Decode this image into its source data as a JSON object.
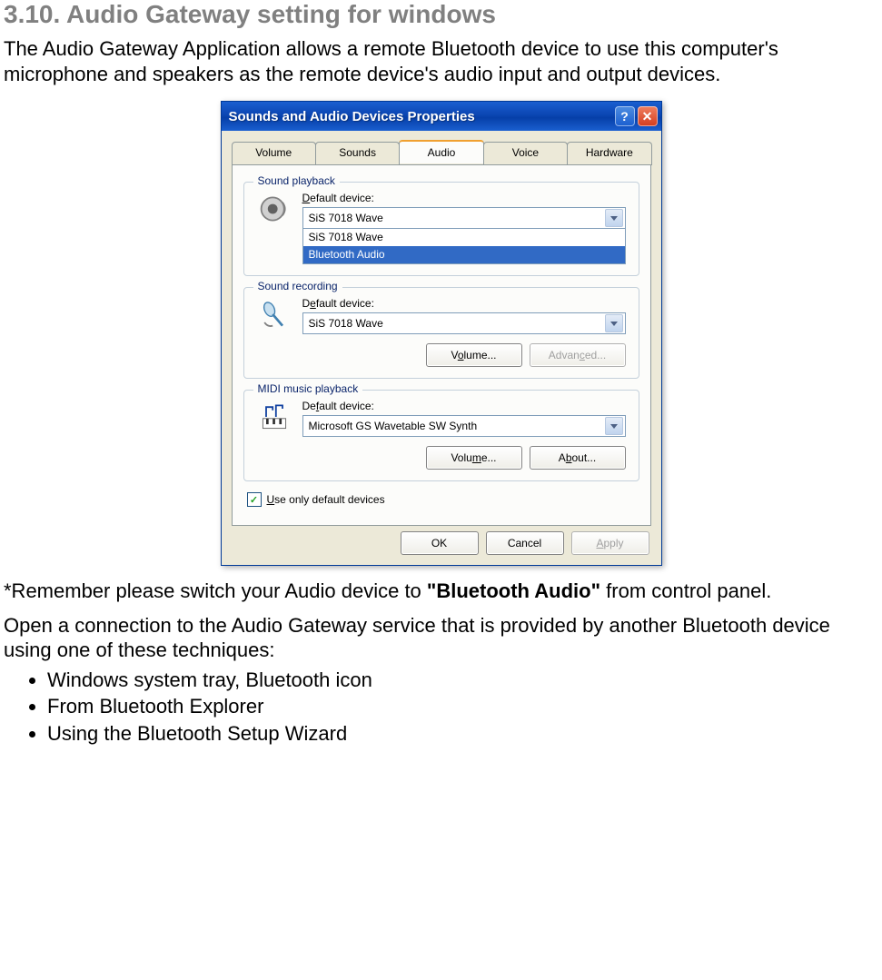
{
  "heading": "3.10. Audio Gateway setting for windows",
  "intro": "The Audio Gateway Application allows a remote Bluetooth device to use this computer's microphone and speakers as the remote device's audio input and output devices.",
  "dialog": {
    "title": "Sounds and Audio Devices Properties",
    "tabs": [
      "Volume",
      "Sounds",
      "Audio",
      "Voice",
      "Hardware"
    ],
    "active_tab_index": 2,
    "playback": {
      "group_title": "Sound playback",
      "label_pre": "D",
      "label_post": "efault device:",
      "value": "SiS 7018 Wave",
      "options": [
        "SiS 7018 Wave",
        "Bluetooth Audio"
      ],
      "selected_option_index": 1
    },
    "recording": {
      "group_title": "Sound recording",
      "label_pre": "D",
      "label_mid": "e",
      "label_post": "fault device:",
      "value": "SiS 7018 Wave",
      "volume_btn_pre": "V",
      "volume_btn_mid": "o",
      "volume_btn_post": "lume...",
      "advanced_btn_pre": "Advan",
      "advanced_btn_mid": "c",
      "advanced_btn_post": "ed..."
    },
    "midi": {
      "group_title": "MIDI music playback",
      "label_pre": "De",
      "label_mid": "f",
      "label_post": "ault device:",
      "value": "Microsoft GS Wavetable SW Synth",
      "volume_btn_pre": "Volu",
      "volume_btn_mid": "m",
      "volume_btn_post": "e...",
      "about_btn_pre": "A",
      "about_btn_mid": "b",
      "about_btn_post": "out..."
    },
    "use_only_default_pre": "",
    "use_only_default_mid": "U",
    "use_only_default_post": "se only default devices",
    "buttons": {
      "ok": "OK",
      "cancel": "Cancel",
      "apply_pre": "",
      "apply_mid": "A",
      "apply_post": "pply"
    }
  },
  "remember_prefix": "*Remember please switch your Audio device to ",
  "remember_bold": "\"Bluetooth Audio\"",
  "remember_suffix": " from control panel.",
  "open_conn": "Open a connection to the Audio Gateway service that is provided by another Bluetooth device using one of these techniques:",
  "bullets": [
    "Windows system tray, Bluetooth icon",
    "From Bluetooth Explorer",
    "Using the Bluetooth Setup Wizard"
  ]
}
